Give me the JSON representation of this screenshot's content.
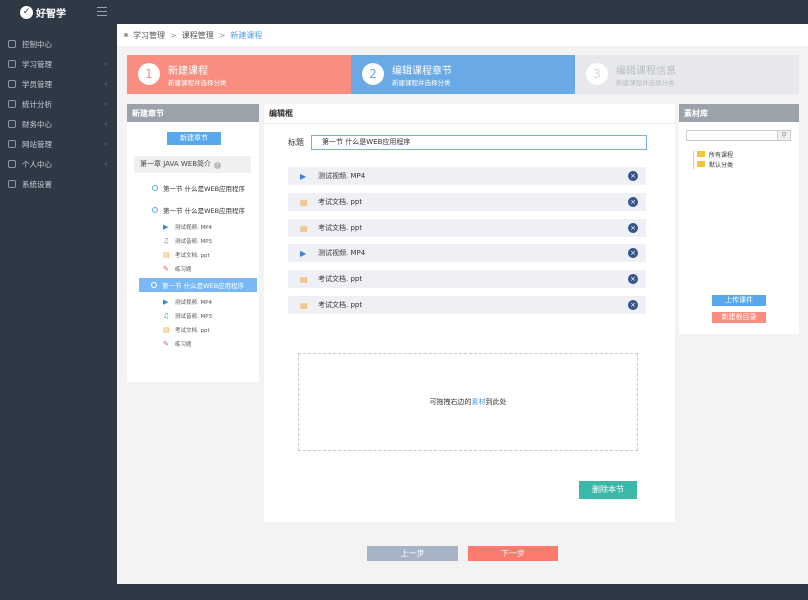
{
  "app": {
    "name": "好智学"
  },
  "sidebar": {
    "items": [
      {
        "label": "控制中心",
        "icon": "home-icon",
        "has_submenu": false
      },
      {
        "label": "学习管理",
        "icon": "book-icon",
        "has_submenu": true
      },
      {
        "label": "学员管理",
        "icon": "user-icon",
        "has_submenu": true
      },
      {
        "label": "统计分析",
        "icon": "chart-icon",
        "has_submenu": true
      },
      {
        "label": "财务中心",
        "icon": "finance-icon",
        "has_submenu": true
      },
      {
        "label": "网站管理",
        "icon": "send-icon",
        "has_submenu": true
      },
      {
        "label": "个人中心",
        "icon": "person-icon",
        "has_submenu": true
      },
      {
        "label": "系统设置",
        "icon": "settings-icon",
        "has_submenu": false
      }
    ]
  },
  "breadcrumb": {
    "items": [
      "学习管理",
      "课程管理"
    ],
    "current": "新建课程",
    "separator": ">"
  },
  "steps": [
    {
      "number": "1",
      "title": "新建课程",
      "subtitle": "新建课程并选择分类",
      "state": "done"
    },
    {
      "number": "2",
      "title": "编辑课程章节",
      "subtitle": "新建课程并选择分类",
      "state": "active"
    },
    {
      "number": "3",
      "title": "编辑课程信息",
      "subtitle": "新建课程并选择分类",
      "state": "pending"
    }
  ],
  "chapters_panel": {
    "title": "新建章节",
    "new_button": "新建章节",
    "chapter": "第一章 JAVA WEB简介",
    "info_icon_text": "i",
    "sections": [
      {
        "label": "第一节  什么是WEB应用程序",
        "selected": false,
        "items": []
      },
      {
        "label": "第一节  什么是WEB应用程序",
        "selected": false,
        "items": [
          {
            "label": "测试视频. MP4",
            "icon": "play-icon",
            "glyph": "▶",
            "color": "#3d82d6"
          },
          {
            "label": "测试音频. MP3",
            "icon": "music-icon",
            "glyph": "♫",
            "color": "#3db34a"
          },
          {
            "label": "考试文档. ppt",
            "icon": "document-icon",
            "glyph": "▤",
            "color": "#f3a33c"
          },
          {
            "label": "练习题",
            "icon": "edit-icon",
            "glyph": "✎",
            "color": "#e4595a"
          }
        ]
      },
      {
        "label": "第一节  什么是WEB应用程序",
        "selected": true,
        "items": [
          {
            "label": "测试视频. MP4",
            "icon": "play-icon",
            "glyph": "▶",
            "color": "#3d82d6"
          },
          {
            "label": "测试音频. MP3",
            "icon": "music-icon",
            "glyph": "♫",
            "color": "#3db34a"
          },
          {
            "label": "考试文档. ppt",
            "icon": "document-icon",
            "glyph": "▤",
            "color": "#f3a33c"
          },
          {
            "label": "练习题",
            "icon": "edit-icon",
            "glyph": "✎",
            "color": "#e4595a"
          }
        ]
      }
    ]
  },
  "editor": {
    "title": "编辑框",
    "title_label": "标题",
    "title_value": "第一节  什么是WEB应用程序",
    "files": [
      {
        "label": "测试视频. MP4",
        "icon": "play-icon",
        "glyph": "▶",
        "color": "#3d82d6"
      },
      {
        "label": "考试文档. ppt",
        "icon": "document-icon",
        "glyph": "▤",
        "color": "#f3a33c"
      },
      {
        "label": "考试文档. ppt",
        "icon": "document-icon",
        "glyph": "▤",
        "color": "#f3a33c"
      },
      {
        "label": "测试视频. MP4",
        "icon": "play-icon",
        "glyph": "▶",
        "color": "#3d82d6"
      },
      {
        "label": "考试文档. ppt",
        "icon": "document-icon",
        "glyph": "▤",
        "color": "#f3a33c"
      },
      {
        "label": "考试文档. ppt",
        "icon": "document-icon",
        "glyph": "▤",
        "color": "#f3a33c"
      }
    ],
    "remove_glyph": "×",
    "dropzone_pre": "可拖拽右边的",
    "dropzone_link": "素材",
    "dropzone_post": "到此处",
    "delete_button": "删除本节"
  },
  "material": {
    "title": "素材库",
    "search_glyph": "⚲",
    "tree": [
      "所有课程",
      "默认分类"
    ],
    "upload_button": "上传课件",
    "new_dir_button": "新建根目录"
  },
  "nav": {
    "prev": "上一步",
    "next": "下一步"
  },
  "colors": {
    "sidebar_bg": "#2f3845",
    "step_done": "#f98d7f",
    "step_active": "#68a9e6",
    "step_pending": "#e7e8ec",
    "primary": "#5aa8ec",
    "delete": "#3bb8a7",
    "next": "#fd7a6f",
    "prev": "#a7b4c5"
  }
}
